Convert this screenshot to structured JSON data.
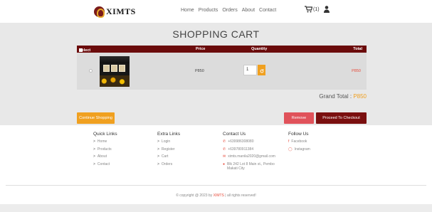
{
  "nav": {
    "brand": "XIMTS",
    "links": [
      "Home",
      "Products",
      "Orders",
      "About",
      "Contact"
    ],
    "cart_count": "(1)"
  },
  "cart": {
    "title": "SHOPPING CART",
    "headers": {
      "select_all": "Select All",
      "price": "Price",
      "quantity": "Quantity",
      "total": "Total"
    },
    "items": [
      {
        "price": "P850",
        "quantity": "1",
        "total": "P850"
      }
    ],
    "grand_total_label": "Grand Total :",
    "grand_total_value": "P850"
  },
  "actions": {
    "continue": "Continue Shopping",
    "remove": "Remove",
    "checkout": "Proceed To Checkout"
  },
  "footer": {
    "quick_links": {
      "title": "Quick Links",
      "items": [
        "Home",
        "Products",
        "About",
        "Contact"
      ]
    },
    "extra_links": {
      "title": "Extra Links",
      "items": [
        "Login",
        "Register",
        "Cart",
        "Orders"
      ]
    },
    "contact": {
      "title": "Contact Us",
      "phone1": "+639986308080",
      "phone2": "+639780911384",
      "email": "ximts.manila2020@gmail.com",
      "address": "Blk 242 Lot 8 Main st., Pembo Makati City"
    },
    "follow": {
      "title": "Follow Us",
      "items": [
        "Facebook",
        "Instagram"
      ]
    },
    "copyright_prefix": "© copyright @ 2023 by",
    "copyright_brand": "XIMTS",
    "copyright_suffix": "| all rights reserved!"
  },
  "colors": {
    "maroon": "#6b0b0b",
    "orange": "#f0a020",
    "red": "#e0525a",
    "accent_red": "#e74c3c"
  }
}
